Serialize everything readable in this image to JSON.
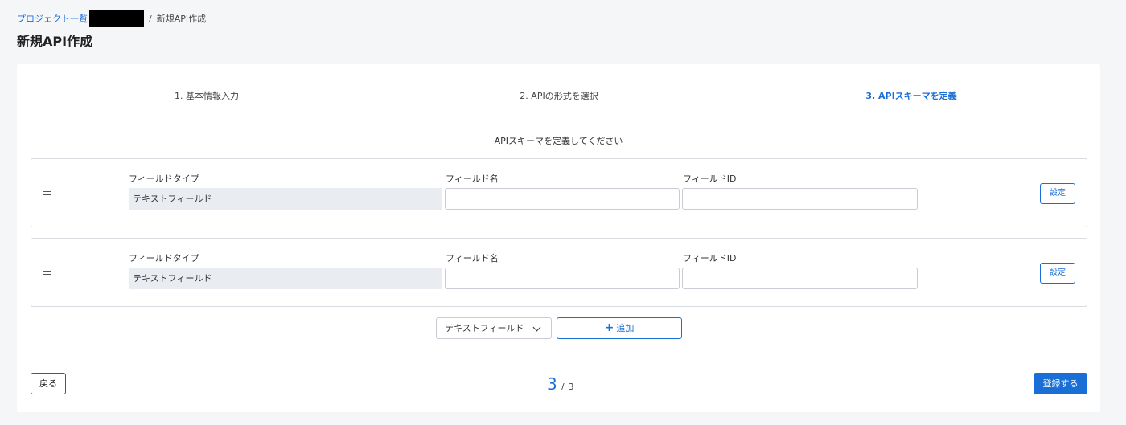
{
  "breadcrumb": {
    "root": "プロジェクト一覧",
    "separator": "/",
    "current": "新規API作成"
  },
  "page_title": "新規API作成",
  "steps": [
    {
      "label": "1. 基本情報入力",
      "active": false
    },
    {
      "label": "2. APIの形式を選択",
      "active": false
    },
    {
      "label": "3. APIスキーマを定義",
      "active": true
    }
  ],
  "instruction": "APIスキーマを定義してください",
  "field_labels": {
    "type": "フィールドタイプ",
    "name": "フィールド名",
    "id": "フィールドID"
  },
  "fields": [
    {
      "type_value": "テキストフィールド",
      "name_value": "",
      "id_value": "",
      "settings_label": "設定"
    },
    {
      "type_value": "テキストフィールド",
      "name_value": "",
      "id_value": "",
      "settings_label": "設定"
    }
  ],
  "add_controls": {
    "selected_type": "テキストフィールド",
    "add_label": "追加",
    "add_icon": "plus-icon"
  },
  "footer": {
    "back_label": "戻る",
    "current_page": "3",
    "page_separator": "/",
    "total_pages": "3",
    "register_label": "登録する"
  },
  "colors": {
    "accent": "#1a6fd6",
    "background": "#f5f6f8",
    "readonly_field": "#e9ecf0"
  }
}
